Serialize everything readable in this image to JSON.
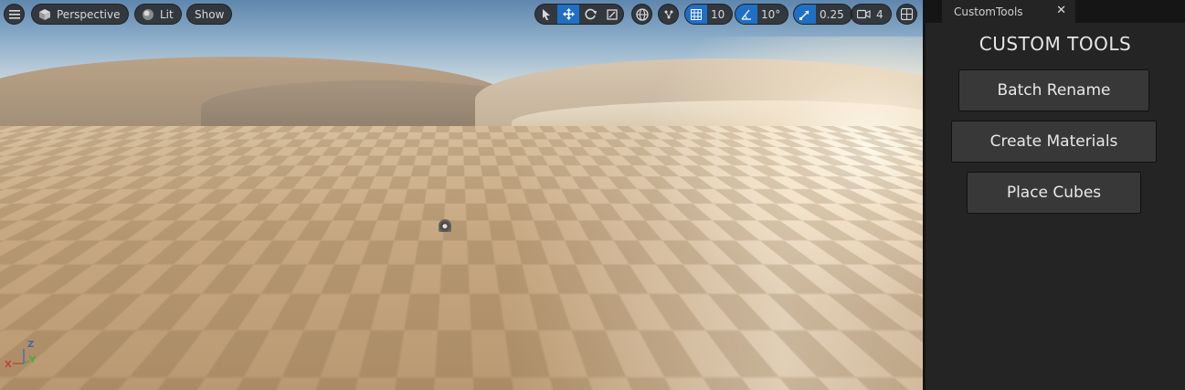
{
  "viewport": {
    "menu_icon": "hamburger-icon",
    "perspective_label": "Perspective",
    "lit_label": "Lit",
    "show_label": "Show",
    "grid_snap_value": "10",
    "rotation_snap_value": "10°",
    "scale_snap_value": "0.25",
    "camera_speed_value": "4",
    "axis": {
      "x": "X",
      "y": "Y",
      "z": "Z"
    },
    "accent_color": "#1f6fc5"
  },
  "panel": {
    "tab_label": "CustomTools",
    "close_glyph": "✕",
    "title": "CUSTOM TOOLS",
    "buttons": {
      "batch_rename": "Batch Rename",
      "create_materials": "Create Materials",
      "place_cubes": "Place Cubes"
    }
  }
}
